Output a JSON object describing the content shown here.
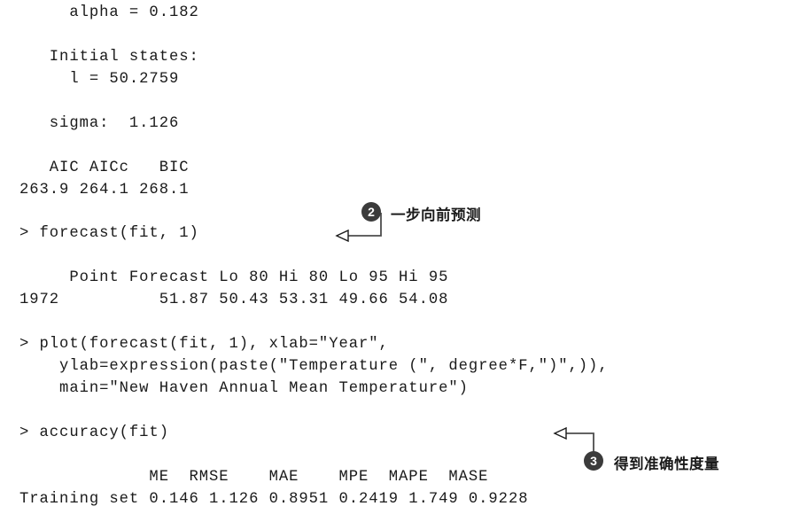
{
  "page": {
    "background_color": "#ffffff",
    "text_color": "#1a1a1a",
    "badge_color": "#3b3b3b",
    "badge_text_color": "#ffffff",
    "leader_color": "#4d4d4d"
  },
  "console": {
    "lines": [
      {
        "id": "line-alpha",
        "text": "     alpha = 0.182"
      },
      {
        "id": "line-initial-states",
        "text": "   Initial states:"
      },
      {
        "id": "line-l-value",
        "text": "     l = 50.2759"
      },
      {
        "id": "line-sigma",
        "text": "   sigma:  1.126"
      },
      {
        "id": "line-ic-header",
        "text": "   AIC AICc   BIC"
      },
      {
        "id": "line-ic-values",
        "text": "263.9 264.1 268.1"
      },
      {
        "id": "line-cmd-forecast",
        "text": "> forecast(fit, 1)"
      },
      {
        "id": "line-forecast-header",
        "text": "     Point Forecast Lo 80 Hi 80 Lo 95 Hi 95"
      },
      {
        "id": "line-forecast-values",
        "text": "1972          51.87 50.43 53.31 49.66 54.08"
      },
      {
        "id": "line-cmd-plot-1",
        "text": "> plot(forecast(fit, 1), xlab=\"Year\","
      },
      {
        "id": "line-cmd-plot-2",
        "text": "    ylab=expression(paste(\"Temperature (\", degree*F,\")\",)),"
      },
      {
        "id": "line-cmd-plot-3",
        "text": "    main=\"New Haven Annual Mean Temperature\")"
      },
      {
        "id": "line-cmd-accuracy",
        "text": "> accuracy(fit)"
      },
      {
        "id": "line-accuracy-header",
        "text": "             ME  RMSE    MAE    MPE  MAPE  MASE"
      },
      {
        "id": "line-accuracy-values",
        "text": "Training set 0.146 1.126 0.8951 0.2419 1.749 0.9228"
      }
    ],
    "forecast_table": {
      "columns": [
        "",
        "Point Forecast",
        "Lo 80",
        "Hi 80",
        "Lo 95",
        "Hi 95"
      ],
      "rows": [
        {
          "period": "1972",
          "point_forecast": "51.87",
          "lo_80": "50.43",
          "hi_80": "53.31",
          "lo_95": "49.66",
          "hi_95": "54.08"
        }
      ]
    },
    "accuracy_table": {
      "columns": [
        "",
        "ME",
        "RMSE",
        "MAE",
        "MPE",
        "MAPE",
        "MASE"
      ],
      "rows": [
        {
          "set": "Training set",
          "me": "0.146",
          "rmse": "1.126",
          "mae": "0.8951",
          "mpe": "0.2419",
          "mape": "1.749",
          "mase": "0.9228"
        }
      ]
    },
    "model_summary": {
      "alpha": "0.182",
      "initial_state_l": "50.2759",
      "sigma": "1.126",
      "aic": "263.9",
      "aicc": "264.1",
      "bic": "268.1"
    }
  },
  "annotations": [
    {
      "id": "callout-2",
      "number": "2",
      "label": "一步向前预测",
      "target_line": "line-cmd-forecast"
    },
    {
      "id": "callout-3",
      "number": "3",
      "label": "得到准确性度量",
      "target_line": "line-cmd-accuracy"
    }
  ]
}
